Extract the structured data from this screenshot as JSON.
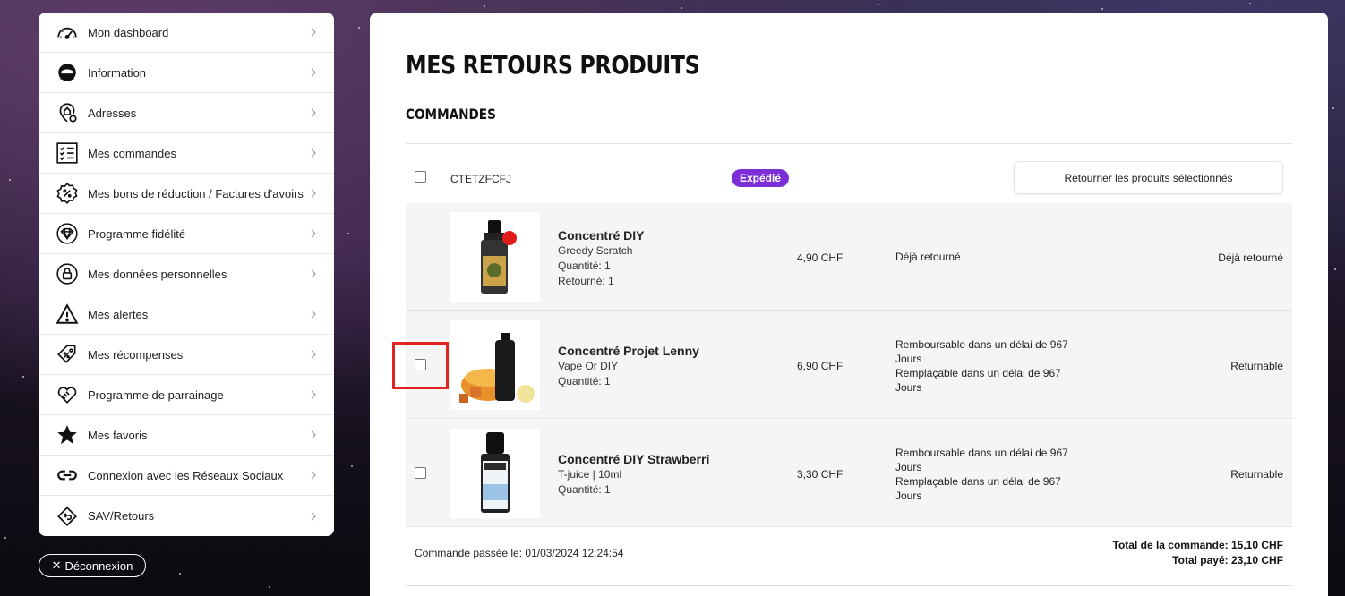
{
  "sidebar": {
    "items": [
      {
        "label": "Mon dashboard",
        "icon": "speedometer-icon"
      },
      {
        "label": "Information",
        "icon": "astronaut-helmet-icon"
      },
      {
        "label": "Adresses",
        "icon": "home-location-icon"
      },
      {
        "label": "Mes commandes",
        "icon": "checklist-icon"
      },
      {
        "label": "Mes bons de réduction / Factures d'avoirs",
        "icon": "discount-badge-icon"
      },
      {
        "label": "Programme fidélité",
        "icon": "diamond-icon"
      },
      {
        "label": "Mes données personnelles",
        "icon": "lock-icon"
      },
      {
        "label": "Mes alertes",
        "icon": "warning-icon"
      },
      {
        "label": "Mes récompenses",
        "icon": "price-tag-icon"
      },
      {
        "label": "Programme de parrainage",
        "icon": "handshake-icon"
      },
      {
        "label": "Mes favoris",
        "icon": "star-icon"
      },
      {
        "label": "Connexion avec les Réseaux Sociaux",
        "icon": "link-icon"
      },
      {
        "label": "SAV/Retours",
        "icon": "return-arrows-icon"
      }
    ],
    "logout_label": "Déconnexion"
  },
  "main": {
    "title": "MES RETOURS PRODUITS",
    "section": "COMMANDES",
    "order": {
      "id": "CTETZFCFJ",
      "status_badge": "Expédié",
      "return_button": "Retourner les produits sélectionnés",
      "badge_color": "#7b2fd8",
      "products": [
        {
          "name": "Concentré DIY",
          "brand": "Greedy Scratch",
          "quantity": "Quantité: 1",
          "returned": "Retourné: 1",
          "price": "4,90 CHF",
          "status_lines": [
            "Déjà retourné"
          ],
          "state": "Déjà retourné",
          "selectable": false
        },
        {
          "name": "Concentré Projet Lenny",
          "brand": "Vape Or DIY",
          "quantity": "Quantité: 1",
          "returned": "",
          "price": "6,90 CHF",
          "status_lines": [
            "Remboursable dans un délai de 967 Jours",
            "Remplaçable dans un délai de 967 Jours"
          ],
          "state": "Returnable",
          "selectable": true
        },
        {
          "name": "Concentré DIY Strawberri",
          "brand": "T-juice | 10ml",
          "quantity": "Quantité: 1",
          "returned": "",
          "price": "3,30 CHF",
          "status_lines": [
            "Remboursable dans un délai de 967 Jours",
            "Remplaçable dans un délai de 967 Jours"
          ],
          "state": "Returnable",
          "selectable": true
        }
      ],
      "placed_on": "Commande passée le: 01/03/2024 12:24:54",
      "total_order": "Total de la commande: 15,10 CHF",
      "total_paid": "Total payé: 23,10 CHF"
    }
  }
}
